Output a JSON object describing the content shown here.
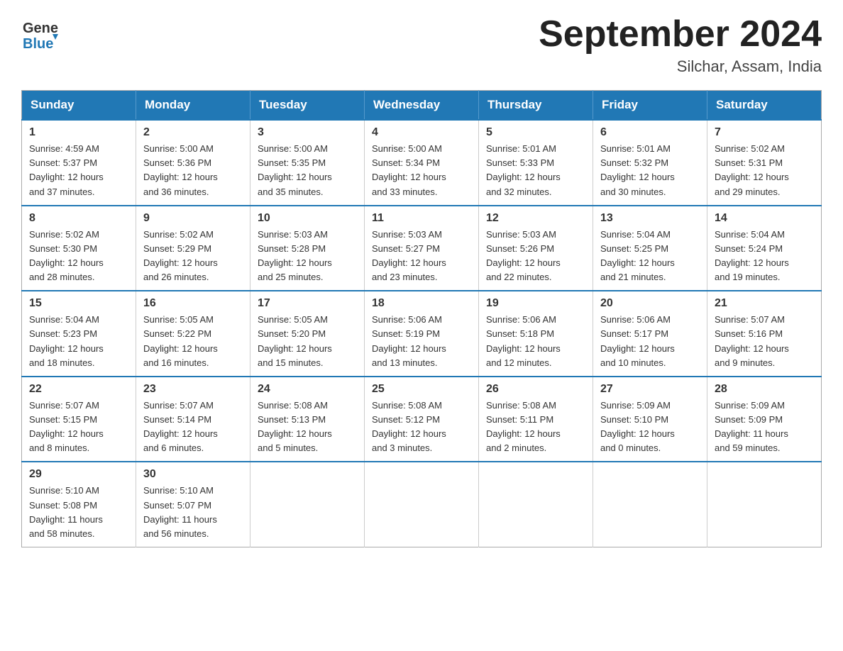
{
  "header": {
    "logo_general": "General",
    "logo_blue": "Blue",
    "title": "September 2024",
    "subtitle": "Silchar, Assam, India"
  },
  "weekdays": [
    "Sunday",
    "Monday",
    "Tuesday",
    "Wednesday",
    "Thursday",
    "Friday",
    "Saturday"
  ],
  "weeks": [
    [
      {
        "day": "1",
        "info": "Sunrise: 4:59 AM\nSunset: 5:37 PM\nDaylight: 12 hours\nand 37 minutes."
      },
      {
        "day": "2",
        "info": "Sunrise: 5:00 AM\nSunset: 5:36 PM\nDaylight: 12 hours\nand 36 minutes."
      },
      {
        "day": "3",
        "info": "Sunrise: 5:00 AM\nSunset: 5:35 PM\nDaylight: 12 hours\nand 35 minutes."
      },
      {
        "day": "4",
        "info": "Sunrise: 5:00 AM\nSunset: 5:34 PM\nDaylight: 12 hours\nand 33 minutes."
      },
      {
        "day": "5",
        "info": "Sunrise: 5:01 AM\nSunset: 5:33 PM\nDaylight: 12 hours\nand 32 minutes."
      },
      {
        "day": "6",
        "info": "Sunrise: 5:01 AM\nSunset: 5:32 PM\nDaylight: 12 hours\nand 30 minutes."
      },
      {
        "day": "7",
        "info": "Sunrise: 5:02 AM\nSunset: 5:31 PM\nDaylight: 12 hours\nand 29 minutes."
      }
    ],
    [
      {
        "day": "8",
        "info": "Sunrise: 5:02 AM\nSunset: 5:30 PM\nDaylight: 12 hours\nand 28 minutes."
      },
      {
        "day": "9",
        "info": "Sunrise: 5:02 AM\nSunset: 5:29 PM\nDaylight: 12 hours\nand 26 minutes."
      },
      {
        "day": "10",
        "info": "Sunrise: 5:03 AM\nSunset: 5:28 PM\nDaylight: 12 hours\nand 25 minutes."
      },
      {
        "day": "11",
        "info": "Sunrise: 5:03 AM\nSunset: 5:27 PM\nDaylight: 12 hours\nand 23 minutes."
      },
      {
        "day": "12",
        "info": "Sunrise: 5:03 AM\nSunset: 5:26 PM\nDaylight: 12 hours\nand 22 minutes."
      },
      {
        "day": "13",
        "info": "Sunrise: 5:04 AM\nSunset: 5:25 PM\nDaylight: 12 hours\nand 21 minutes."
      },
      {
        "day": "14",
        "info": "Sunrise: 5:04 AM\nSunset: 5:24 PM\nDaylight: 12 hours\nand 19 minutes."
      }
    ],
    [
      {
        "day": "15",
        "info": "Sunrise: 5:04 AM\nSunset: 5:23 PM\nDaylight: 12 hours\nand 18 minutes."
      },
      {
        "day": "16",
        "info": "Sunrise: 5:05 AM\nSunset: 5:22 PM\nDaylight: 12 hours\nand 16 minutes."
      },
      {
        "day": "17",
        "info": "Sunrise: 5:05 AM\nSunset: 5:20 PM\nDaylight: 12 hours\nand 15 minutes."
      },
      {
        "day": "18",
        "info": "Sunrise: 5:06 AM\nSunset: 5:19 PM\nDaylight: 12 hours\nand 13 minutes."
      },
      {
        "day": "19",
        "info": "Sunrise: 5:06 AM\nSunset: 5:18 PM\nDaylight: 12 hours\nand 12 minutes."
      },
      {
        "day": "20",
        "info": "Sunrise: 5:06 AM\nSunset: 5:17 PM\nDaylight: 12 hours\nand 10 minutes."
      },
      {
        "day": "21",
        "info": "Sunrise: 5:07 AM\nSunset: 5:16 PM\nDaylight: 12 hours\nand 9 minutes."
      }
    ],
    [
      {
        "day": "22",
        "info": "Sunrise: 5:07 AM\nSunset: 5:15 PM\nDaylight: 12 hours\nand 8 minutes."
      },
      {
        "day": "23",
        "info": "Sunrise: 5:07 AM\nSunset: 5:14 PM\nDaylight: 12 hours\nand 6 minutes."
      },
      {
        "day": "24",
        "info": "Sunrise: 5:08 AM\nSunset: 5:13 PM\nDaylight: 12 hours\nand 5 minutes."
      },
      {
        "day": "25",
        "info": "Sunrise: 5:08 AM\nSunset: 5:12 PM\nDaylight: 12 hours\nand 3 minutes."
      },
      {
        "day": "26",
        "info": "Sunrise: 5:08 AM\nSunset: 5:11 PM\nDaylight: 12 hours\nand 2 minutes."
      },
      {
        "day": "27",
        "info": "Sunrise: 5:09 AM\nSunset: 5:10 PM\nDaylight: 12 hours\nand 0 minutes."
      },
      {
        "day": "28",
        "info": "Sunrise: 5:09 AM\nSunset: 5:09 PM\nDaylight: 11 hours\nand 59 minutes."
      }
    ],
    [
      {
        "day": "29",
        "info": "Sunrise: 5:10 AM\nSunset: 5:08 PM\nDaylight: 11 hours\nand 58 minutes."
      },
      {
        "day": "30",
        "info": "Sunrise: 5:10 AM\nSunset: 5:07 PM\nDaylight: 11 hours\nand 56 minutes."
      },
      {
        "day": "",
        "info": ""
      },
      {
        "day": "",
        "info": ""
      },
      {
        "day": "",
        "info": ""
      },
      {
        "day": "",
        "info": ""
      },
      {
        "day": "",
        "info": ""
      }
    ]
  ]
}
